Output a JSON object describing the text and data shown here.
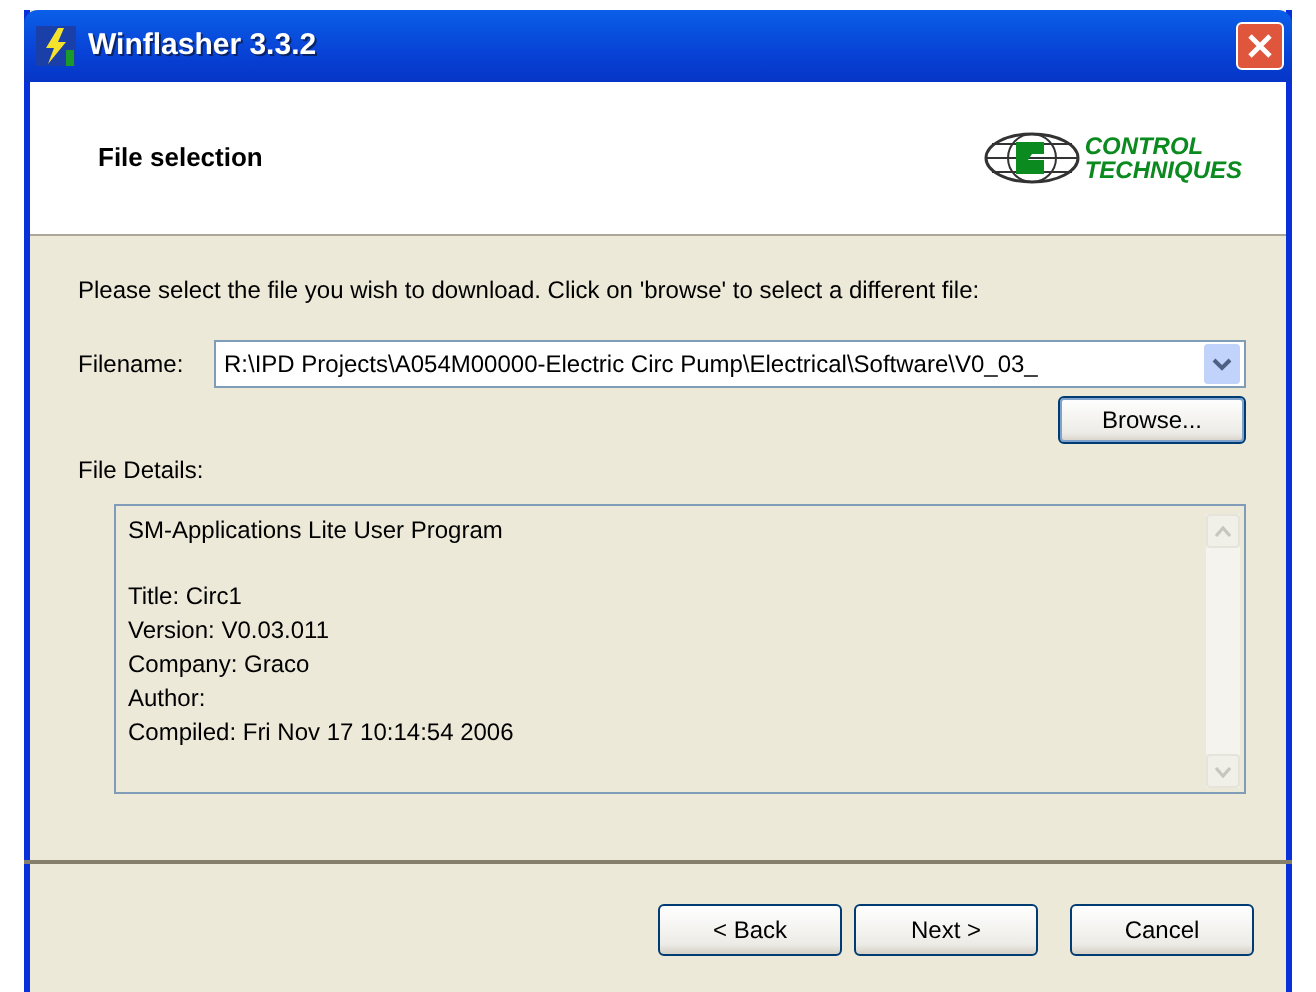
{
  "window": {
    "title": "Winflasher 3.3.2"
  },
  "header": {
    "title": "File selection",
    "logo": [
      "CONTROL",
      "TECHNIQUES"
    ]
  },
  "instruction": "Please select the file you wish to download. Click on 'browse' to select a different file:",
  "filename": {
    "label": "Filename:",
    "value": "R:\\IPD Projects\\A054M00000-Electric Circ Pump\\Electrical\\Software\\V0_03_"
  },
  "browse_button": "Browse...",
  "file_details": {
    "label": "File Details:",
    "paragraphs": [
      [
        "SM-Applications Lite User Program"
      ],
      [
        "Title: Circ1",
        "Version: V0.03.011",
        "Company: Graco",
        "Author:",
        "Compiled: Fri Nov 17 10:14:54 2006"
      ]
    ]
  },
  "buttons": [
    {
      "label": "< Back",
      "kind": "nav"
    },
    {
      "label": "Next >",
      "kind": "nav"
    },
    {
      "label": "Cancel",
      "kind": "cancel"
    }
  ]
}
